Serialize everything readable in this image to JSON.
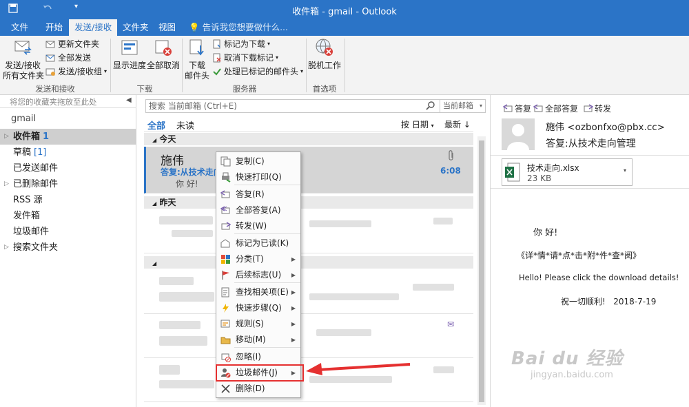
{
  "title": "收件箱 - gmail - Outlook",
  "tabs": [
    "文件",
    "开始",
    "发送/接收",
    "文件夹",
    "视图"
  ],
  "tell_me": "告诉我您想要做什么...",
  "ribbon": {
    "send_receive_all": [
      "发送/接收",
      "所有文件夹"
    ],
    "update_folder": "更新文件夹",
    "send_all": "全部发送",
    "send_receive_groups": "发送/接收组",
    "group1": "发送和接收",
    "show_progress": "显示进度",
    "cancel_all": "全部取消",
    "group2": "下载",
    "download": [
      "下载",
      "邮件头"
    ],
    "mark_download": "标记为下载",
    "unmark_download": "取消下载标记",
    "process_marked": "处理已标记的邮件头",
    "group3": "服务器",
    "offline": "脱机工作",
    "group4": "首选项"
  },
  "folders": {
    "fav_hint": "将您的收藏夹拖放至此处",
    "account": "gmail",
    "items": [
      {
        "label": "收件箱",
        "count": "1"
      },
      {
        "label": "草稿",
        "count": "[1]"
      },
      {
        "label": "已发送邮件",
        "count": ""
      },
      {
        "label": "已删除邮件",
        "count": ""
      },
      {
        "label": "RSS 源",
        "count": ""
      },
      {
        "label": "发件箱",
        "count": ""
      },
      {
        "label": "垃圾邮件",
        "count": ""
      },
      {
        "label": "搜索文件夹",
        "count": ""
      }
    ]
  },
  "list": {
    "search_placeholder": "搜索 当前邮箱 (Ctrl+E)",
    "scope": "当前邮箱",
    "all": "全部",
    "unread": "未读",
    "sort": "按 日期",
    "order": "最新",
    "today": "今天",
    "yesterday": "昨天",
    "selected_mail": {
      "sender": "施伟",
      "subject": "答复:从技术走向",
      "preview": "你 好!",
      "time": "6:08"
    }
  },
  "context_menu": [
    {
      "label": "复制(C)",
      "sub": false
    },
    {
      "label": "快速打印(Q)",
      "sub": false
    },
    {
      "label": "答复(R)",
      "sub": false
    },
    {
      "label": "全部答复(A)",
      "sub": false
    },
    {
      "label": "转发(W)",
      "sub": false
    },
    {
      "label": "标记为已读(K)",
      "sub": false
    },
    {
      "label": "分类(T)",
      "sub": true
    },
    {
      "label": "后续标志(U)",
      "sub": true
    },
    {
      "label": "查找相关项(E)",
      "sub": true
    },
    {
      "label": "快速步骤(Q)",
      "sub": true
    },
    {
      "label": "规则(S)",
      "sub": true
    },
    {
      "label": "移动(M)",
      "sub": true
    },
    {
      "label": "忽略(I)",
      "sub": false
    },
    {
      "label": "垃圾邮件(J)",
      "sub": true
    },
    {
      "label": "删除(D)",
      "sub": false
    }
  ],
  "reading": {
    "reply": "答复",
    "reply_all": "全部答复",
    "forward": "转发",
    "from": "施伟 <ozbonfxo@pbx.cc>",
    "subject": "答复:从技术走向管理",
    "attachment_name": "技术走向.xlsx",
    "attachment_size": "23 KB",
    "body": [
      "你 好!",
      "《详*情*请*点*击*附*件*查*阅》",
      "Hello! Please click the download details!",
      "祝一切顺利!   2018-7-19"
    ]
  },
  "watermark": {
    "brand": "Bai du 经验",
    "url": "jingyan.baidu.com"
  },
  "colors": {
    "accent": "#2b74c7",
    "highlight": "#e53030"
  }
}
